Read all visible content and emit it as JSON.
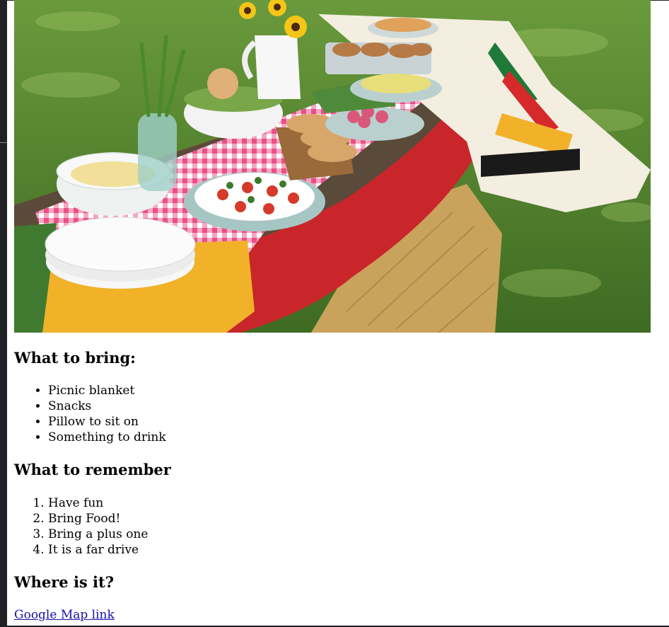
{
  "image": {
    "alt": "",
    "colors": {
      "grass": "#4f7d2c",
      "canoe": "#c8262b",
      "tablecloth": "#ef5b8e",
      "blanket_yellow": "#f1b22a",
      "hay": "#c9a35c"
    }
  },
  "sections": {
    "bring": {
      "heading": "What to bring:",
      "items": [
        "Picnic blanket",
        "Snacks",
        "Pillow to sit on",
        "Something to drink"
      ]
    },
    "remember": {
      "heading": "What to remember",
      "items": [
        "Have fun",
        "Bring Food!",
        "Bring a plus one",
        "It is a far drive"
      ]
    },
    "where": {
      "heading": "Where is it?",
      "link_text": "Google Map link"
    }
  }
}
